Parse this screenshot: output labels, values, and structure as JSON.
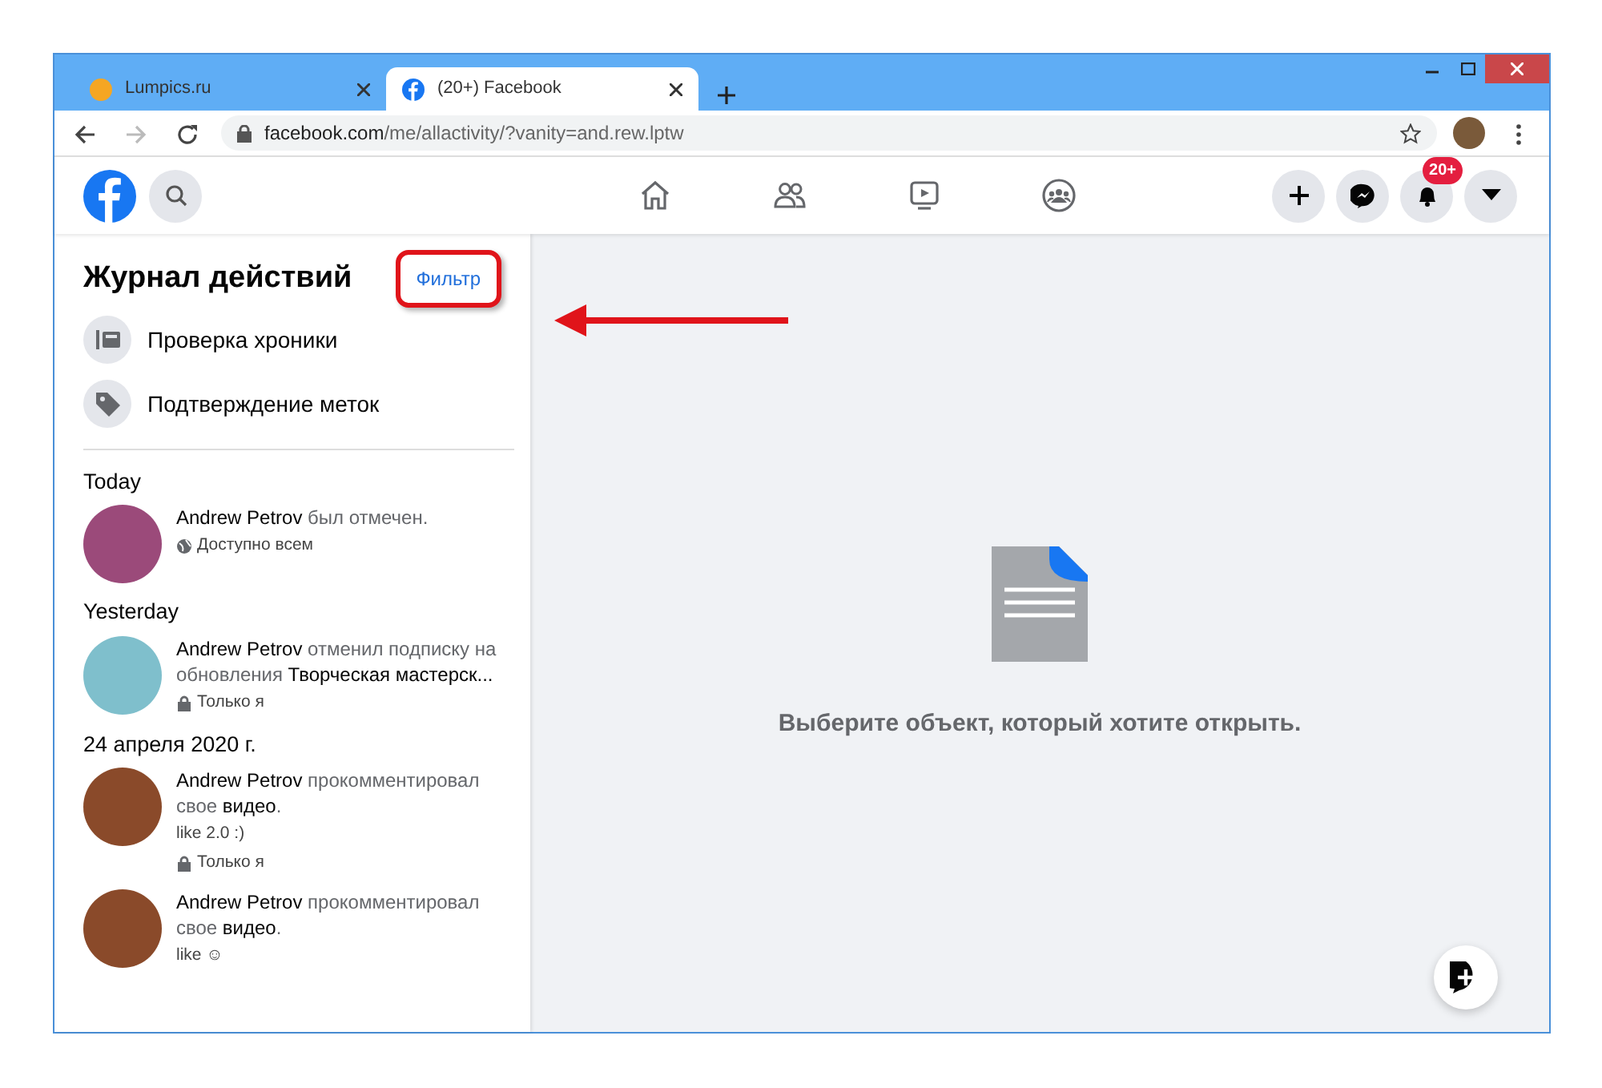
{
  "browser": {
    "tabs": [
      {
        "title": "Lumpics.ru",
        "selected": false
      },
      {
        "title": "(20+) Facebook",
        "selected": true
      }
    ],
    "url_host": "facebook.com",
    "url_path": "/me/allactivity/?vanity=and.rew.lptw"
  },
  "header": {
    "notification_badge": "20+"
  },
  "sidebar": {
    "title": "Журнал действий",
    "filter_button": "Фильтр",
    "tools": [
      {
        "label": "Проверка хроники",
        "kind": "timeline"
      },
      {
        "label": "Подтверждение меток",
        "kind": "tag"
      }
    ],
    "groups": [
      {
        "date": "Today",
        "entries": [
          {
            "text": "**Andrew Petrov** был отмечен.",
            "privacy": "Доступно всем",
            "kind": "public",
            "color": "#9b4a7a"
          }
        ]
      },
      {
        "date": "Yesterday",
        "entries": [
          {
            "text": "**Andrew Petrov** отменил подписку на обновления **Творческая мастерск...**",
            "privacy": "Только я",
            "kind": "private",
            "color": "#7fbfcc"
          }
        ]
      },
      {
        "date": "24 апреля 2020 г.",
        "entries": [
          {
            "text": "**Andrew Petrov** прокомментировал свое **видео**.",
            "comment": "like 2.0 :)",
            "privacy": "Только я",
            "kind": "private",
            "color": "#8a4a2a"
          },
          {
            "text": "**Andrew Petrov** прокомментировал свое **видео**.",
            "comment": "like ☺",
            "color": "#8a4a2a"
          }
        ]
      }
    ]
  },
  "main": {
    "message": "Выберите объект, который хотите открыть."
  }
}
